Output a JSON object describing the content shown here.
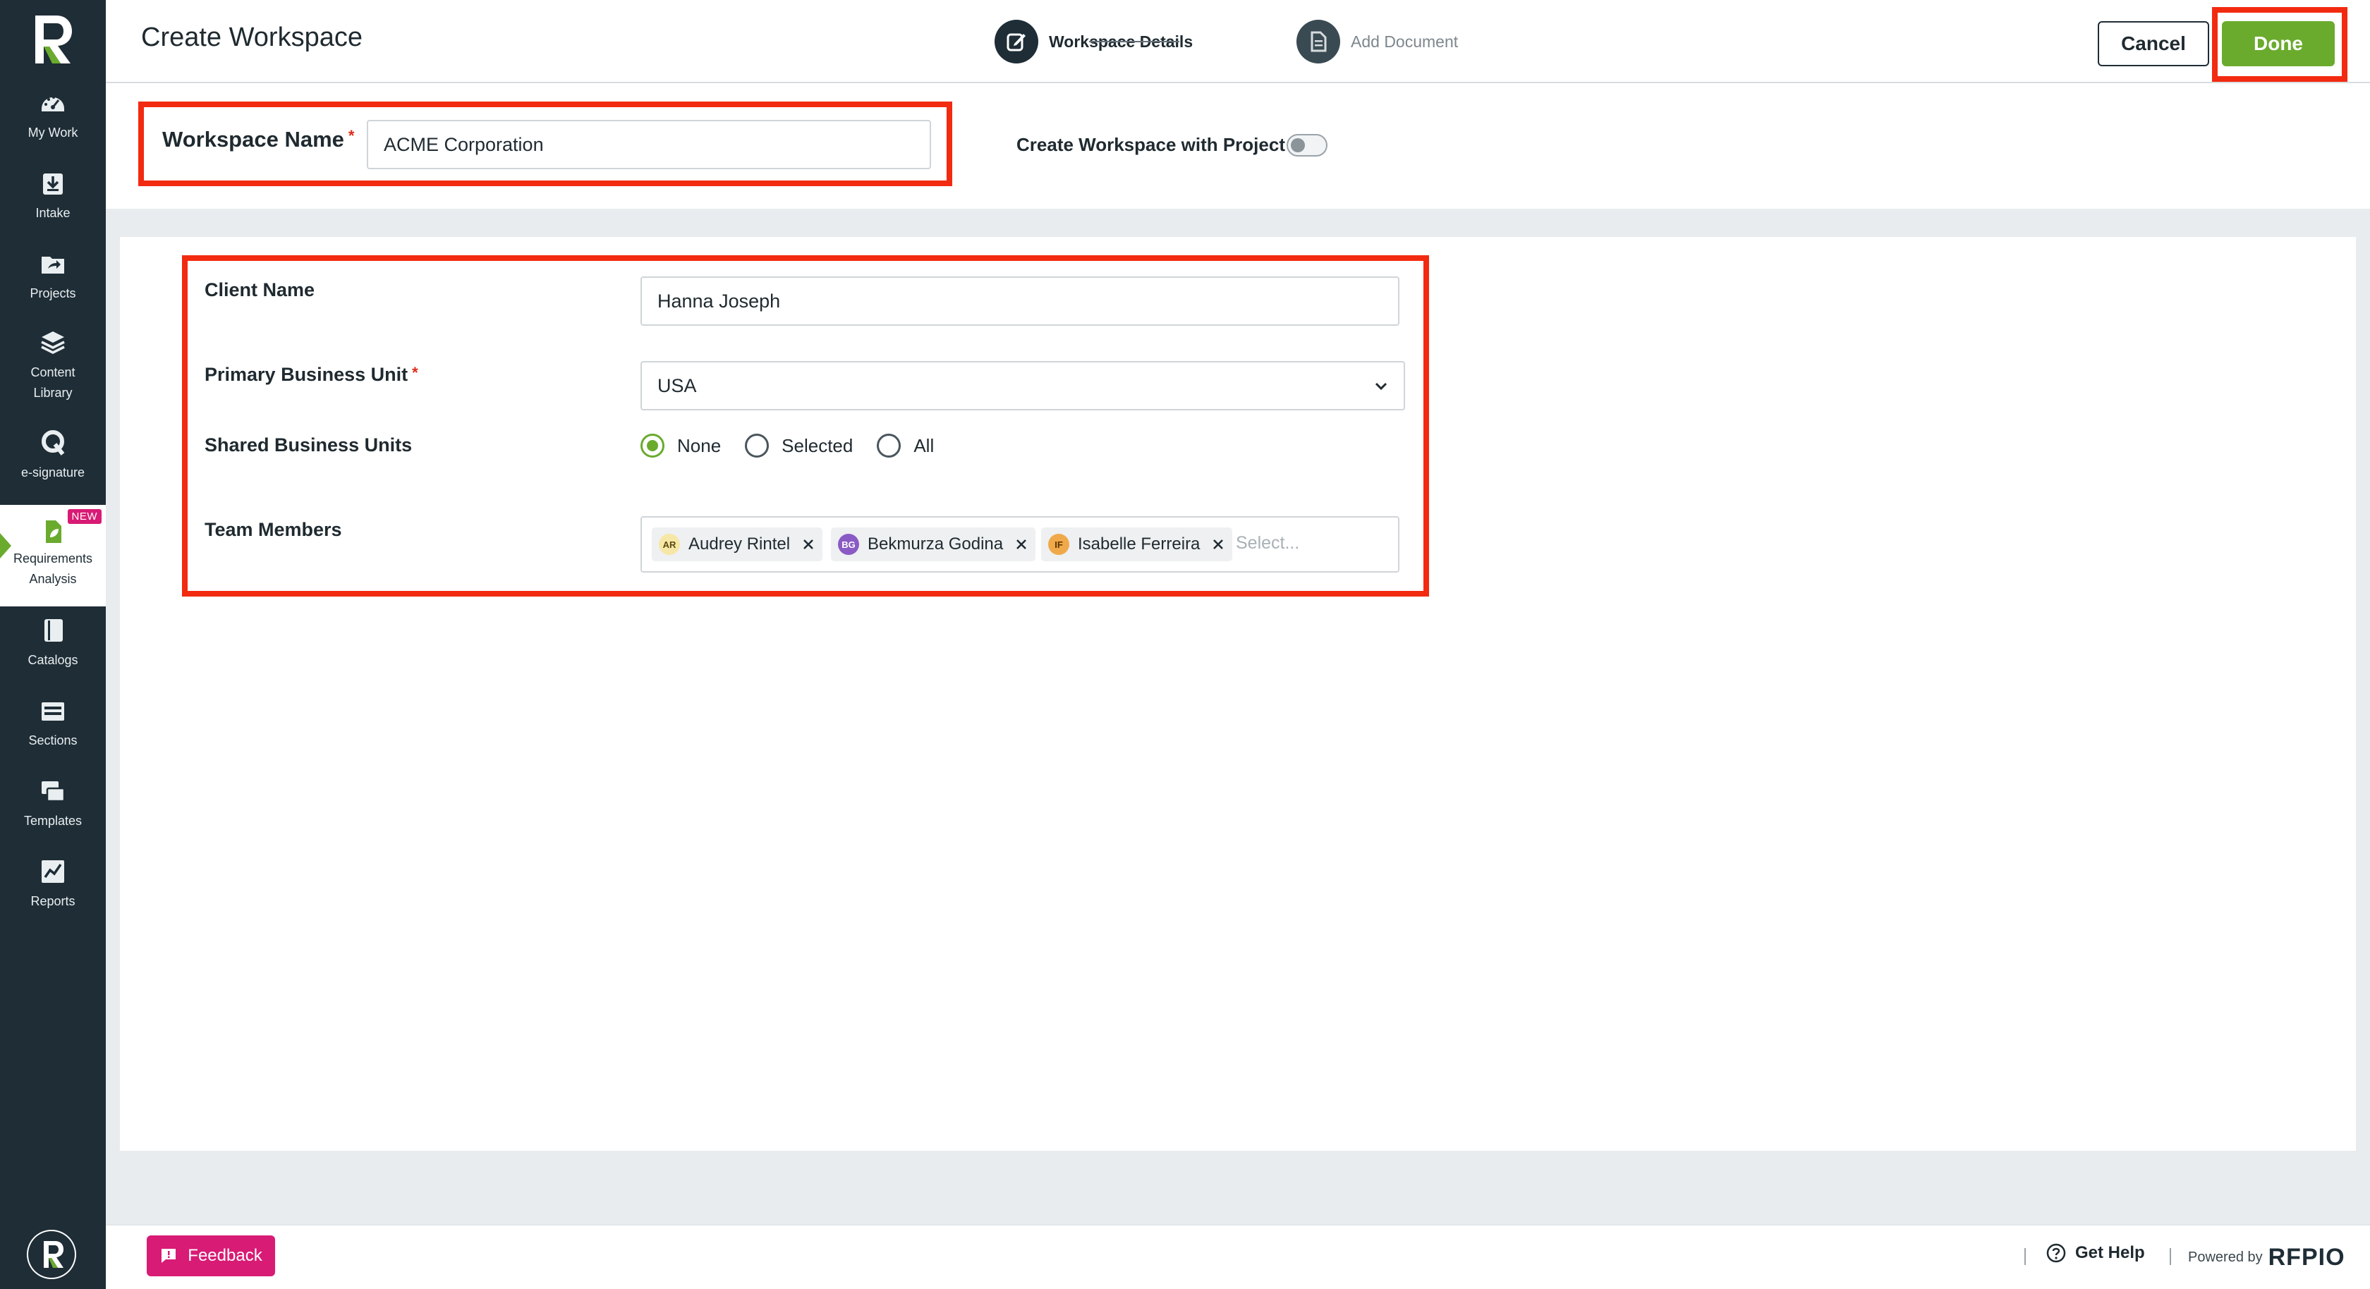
{
  "app": {
    "accent": "#6aab2e",
    "sidebar_bg": "#1e2d36",
    "highlight": "#f22a10"
  },
  "sidebar": {
    "items": [
      {
        "label": "My Work",
        "icon": "gauge-icon"
      },
      {
        "label": "Intake",
        "icon": "inbox-download-icon"
      },
      {
        "label": "Projects",
        "icon": "folder-share-icon"
      },
      {
        "label": "Content\nLibrary",
        "icon": "layers-icon"
      },
      {
        "label": "e-signature",
        "icon": "signature-icon"
      },
      {
        "label": "Requirements\nAnalysis",
        "icon": "document-leaf-icon",
        "badge": "NEW",
        "active": true
      },
      {
        "label": "Catalogs",
        "icon": "book-icon"
      },
      {
        "label": "Sections",
        "icon": "sections-icon"
      },
      {
        "label": "Templates",
        "icon": "templates-icon"
      },
      {
        "label": "Reports",
        "icon": "chart-icon"
      }
    ]
  },
  "header": {
    "title": "Create Workspace",
    "steps": [
      {
        "label": "Workspace Details",
        "state": "current"
      },
      {
        "label": "Add Document",
        "state": "upcoming"
      }
    ],
    "cancel_label": "Cancel",
    "done_label": "Done"
  },
  "workspace": {
    "name_label": "Workspace Name",
    "required_mark": "*",
    "name_value": "ACME Corporation",
    "toggle_label": "Create Workspace with Project",
    "toggle_on": false
  },
  "form": {
    "client_name_label": "Client Name",
    "client_name_value": "Hanna Joseph",
    "primary_bu_label": "Primary Business Unit",
    "primary_bu_value": "USA",
    "shared_bu_label": "Shared Business Units",
    "shared_bu_options": [
      "None",
      "Selected",
      "All"
    ],
    "shared_bu_selected": "None",
    "team_label": "Team Members",
    "team_members": [
      {
        "initials": "AR",
        "name": "Audrey Rintel",
        "color": "#f6e7a6"
      },
      {
        "initials": "BG",
        "name": "Bekmurza Godina",
        "color": "#8a5bc4"
      },
      {
        "initials": "IF",
        "name": "Isabelle Ferreira",
        "color": "#f0a94a"
      }
    ],
    "team_placeholder": "Select..."
  },
  "footer": {
    "feedback_label": "Feedback",
    "get_help_label": "Get Help",
    "powered_by": "Powered by",
    "brand": "RFPIO"
  }
}
